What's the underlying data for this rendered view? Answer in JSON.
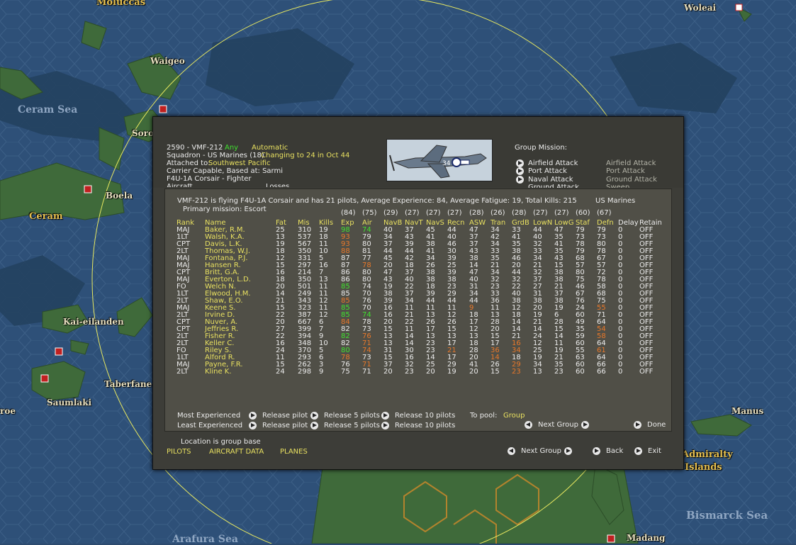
{
  "map": {
    "labels": [
      {
        "text": "Moluccas",
        "kind": "islandName"
      },
      {
        "text": "Waigeo",
        "kind": "land"
      },
      {
        "text": "Ceram Sea",
        "kind": "seaLabel"
      },
      {
        "text": "Soro",
        "kind": "land"
      },
      {
        "text": "Boela",
        "kind": "land"
      },
      {
        "text": "Ceram",
        "kind": "islandName"
      },
      {
        "text": "Kai-eilanden",
        "kind": "land"
      },
      {
        "text": "Taberfane",
        "kind": "land"
      },
      {
        "text": "Saumlaki",
        "kind": "land"
      },
      {
        "text": "roe",
        "kind": "land"
      },
      {
        "text": "Woleai",
        "kind": "land"
      },
      {
        "text": "Manus",
        "kind": "land"
      },
      {
        "text": "Admiralty",
        "kind": "islandName"
      },
      {
        "text": "Islands",
        "kind": "islandName"
      },
      {
        "text": "Bismarck Sea",
        "kind": "seaLabel"
      },
      {
        "text": "Madang",
        "kind": "land"
      },
      {
        "text": "Arafura Sea",
        "kind": "seaLabel"
      }
    ]
  },
  "header": {
    "unit_id": "2590 - VMF-212",
    "any_label": "Any",
    "auto_label": "Automatic",
    "squadron": "Squadron - US Marines (18)",
    "changing": "Changing to 24 in Oct 44",
    "attached_label": "Attached to:",
    "attached_value": "Southwest Pacific",
    "carrier": "Carrier Capable, Based at: Sarmi",
    "aircraft": "F4U-1A Corsair - Fighter",
    "cut_left": "Aircraft",
    "cut_right": "Losses",
    "plane_marking": "34",
    "group_mission_label": "Group Mission:",
    "missions": [
      {
        "label": "Airfield Attack",
        "current": "Airfield Attack"
      },
      {
        "label": "Port Attack",
        "current": "Port Attack"
      },
      {
        "label": "Naval Attack",
        "current": "Ground Attack"
      },
      {
        "label": "Ground Attack",
        "current": "Sweep"
      }
    ]
  },
  "summary": {
    "line": "VMF-212 is flying F4U-1A Corsair and has 21 pilots,  Average Experience: 84, Average Fatigue: 19, Total Kills: 215",
    "service": "US Marines",
    "primary": "Primary mission: Escort"
  },
  "table": {
    "averages": [
      "(84)",
      "(75)",
      "(29)",
      "(27)",
      "(27)",
      "(27)",
      "(28)",
      "(26)",
      "(28)",
      "(27)",
      "(27)",
      "(60)",
      "(67)"
    ],
    "headers": [
      "Rank",
      "Name",
      "Fat",
      "Mis",
      "Kills",
      "Exp",
      "Air",
      "NavB",
      "NavT",
      "NavS",
      "Recn",
      "ASW",
      "Tran",
      "GrdB",
      "LowN",
      "LowG",
      "Staf",
      "Defn",
      "Delay",
      "Retain"
    ],
    "rows": [
      {
        "rank": "MAJ",
        "name": "Baker, R.M.",
        "fat": "25",
        "mis": "310",
        "kills": "19",
        "exp": "98",
        "air": "74",
        "navb": "40",
        "navt": "37",
        "navs": "45",
        "recn": "44",
        "asw": "47",
        "tran": "34",
        "grdb": "33",
        "lown": "44",
        "lowg": "47",
        "staf": "79",
        "defn": "79",
        "delay": "0",
        "retain": "OFF",
        "c": {
          "exp": "g",
          "air": "g"
        }
      },
      {
        "rank": "1LT",
        "name": "Walsh, K.A.",
        "fat": "13",
        "mis": "537",
        "kills": "18",
        "exp": "93",
        "air": "79",
        "navb": "34",
        "navt": "43",
        "navs": "41",
        "recn": "40",
        "asw": "37",
        "tran": "42",
        "grdb": "41",
        "lown": "40",
        "lowg": "35",
        "staf": "73",
        "defn": "73",
        "delay": "0",
        "retain": "OFF",
        "c": {
          "exp": "o"
        }
      },
      {
        "rank": "CPT",
        "name": "Davis, L.K.",
        "fat": "19",
        "mis": "567",
        "kills": "11",
        "exp": "93",
        "air": "80",
        "navb": "37",
        "navt": "39",
        "navs": "38",
        "recn": "46",
        "asw": "37",
        "tran": "34",
        "grdb": "35",
        "lown": "32",
        "lowg": "41",
        "staf": "78",
        "defn": "80",
        "delay": "0",
        "retain": "OFF",
        "c": {
          "exp": "o"
        }
      },
      {
        "rank": "2LT",
        "name": "Thomas, W.J.",
        "fat": "18",
        "mis": "350",
        "kills": "10",
        "exp": "88",
        "air": "81",
        "navb": "44",
        "navt": "44",
        "navs": "41",
        "recn": "30",
        "asw": "43",
        "tran": "33",
        "grdb": "38",
        "lown": "33",
        "lowg": "35",
        "staf": "79",
        "defn": "78",
        "delay": "0",
        "retain": "OFF",
        "c": {
          "exp": "o"
        }
      },
      {
        "rank": "MAJ",
        "name": "Fontana, P.J.",
        "fat": "12",
        "mis": "331",
        "kills": "5",
        "exp": "87",
        "air": "77",
        "navb": "45",
        "navt": "42",
        "navs": "34",
        "recn": "39",
        "asw": "38",
        "tran": "35",
        "grdb": "46",
        "lown": "34",
        "lowg": "43",
        "staf": "68",
        "defn": "67",
        "delay": "0",
        "retain": "OFF",
        "c": {}
      },
      {
        "rank": "MAJ",
        "name": "Hansen R.",
        "fat": "15",
        "mis": "297",
        "kills": "16",
        "exp": "87",
        "air": "78",
        "navb": "20",
        "navt": "18",
        "navs": "26",
        "recn": "25",
        "asw": "14",
        "tran": "21",
        "grdb": "20",
        "lown": "21",
        "lowg": "15",
        "staf": "57",
        "defn": "57",
        "delay": "0",
        "retain": "OFF",
        "c": {
          "air": "o"
        }
      },
      {
        "rank": "CPT",
        "name": "Britt, G.A.",
        "fat": "16",
        "mis": "214",
        "kills": "7",
        "exp": "86",
        "air": "80",
        "navb": "47",
        "navt": "37",
        "navs": "38",
        "recn": "39",
        "asw": "47",
        "tran": "34",
        "grdb": "44",
        "lown": "32",
        "lowg": "38",
        "staf": "80",
        "defn": "72",
        "delay": "0",
        "retain": "OFF",
        "c": {}
      },
      {
        "rank": "MAJ",
        "name": "Everton, L.D.",
        "fat": "18",
        "mis": "350",
        "kills": "13",
        "exp": "86",
        "air": "80",
        "navb": "43",
        "navt": "40",
        "navs": "38",
        "recn": "38",
        "asw": "40",
        "tran": "32",
        "grdb": "32",
        "lown": "37",
        "lowg": "38",
        "staf": "75",
        "defn": "78",
        "delay": "0",
        "retain": "OFF",
        "c": {}
      },
      {
        "rank": "FO",
        "name": "Welch N.",
        "fat": "20",
        "mis": "501",
        "kills": "11",
        "exp": "85",
        "air": "74",
        "navb": "19",
        "navt": "22",
        "navs": "18",
        "recn": "23",
        "asw": "31",
        "tran": "23",
        "grdb": "22",
        "lown": "27",
        "lowg": "21",
        "staf": "46",
        "defn": "58",
        "delay": "0",
        "retain": "OFF",
        "c": {
          "exp": "g"
        }
      },
      {
        "rank": "1LT",
        "name": "Elwood, H.M.",
        "fat": "14",
        "mis": "249",
        "kills": "11",
        "exp": "85",
        "air": "70",
        "navb": "38",
        "navt": "37",
        "navs": "39",
        "recn": "29",
        "asw": "34",
        "tran": "33",
        "grdb": "40",
        "lown": "31",
        "lowg": "37",
        "staf": "67",
        "defn": "68",
        "delay": "0",
        "retain": "OFF",
        "c": {}
      },
      {
        "rank": "2LT",
        "name": "Shaw, E.O.",
        "fat": "21",
        "mis": "343",
        "kills": "12",
        "exp": "85",
        "air": "76",
        "navb": "39",
        "navt": "34",
        "navs": "44",
        "recn": "44",
        "asw": "44",
        "tran": "36",
        "grdb": "38",
        "lown": "38",
        "lowg": "38",
        "staf": "76",
        "defn": "75",
        "delay": "0",
        "retain": "OFF",
        "c": {
          "exp": "o"
        }
      },
      {
        "rank": "MAJ",
        "name": "Keene S.",
        "fat": "15",
        "mis": "323",
        "kills": "11",
        "exp": "85",
        "air": "70",
        "navb": "16",
        "navt": "11",
        "navs": "11",
        "recn": "11",
        "asw": "9",
        "tran": "11",
        "grdb": "12",
        "lown": "20",
        "lowg": "19",
        "staf": "24",
        "defn": "55",
        "delay": "0",
        "retain": "OFF",
        "c": {
          "exp": "g",
          "asw": "o",
          "defn": "o"
        }
      },
      {
        "rank": "2LT",
        "name": "Irvine D.",
        "fat": "22",
        "mis": "387",
        "kills": "12",
        "exp": "85",
        "air": "74",
        "navb": "16",
        "navt": "21",
        "navs": "13",
        "recn": "12",
        "asw": "18",
        "tran": "13",
        "grdb": "18",
        "lown": "19",
        "lowg": "6",
        "staf": "60",
        "defn": "71",
        "delay": "0",
        "retain": "OFF",
        "c": {
          "exp": "g",
          "air": "g"
        }
      },
      {
        "rank": "CPT",
        "name": "Nuver, A.",
        "fat": "20",
        "mis": "667",
        "kills": "6",
        "exp": "84",
        "air": "78",
        "navb": "20",
        "navt": "22",
        "navs": "26",
        "recn": "26",
        "asw": "17",
        "tran": "28",
        "grdb": "14",
        "lown": "21",
        "lowg": "28",
        "staf": "49",
        "defn": "64",
        "delay": "0",
        "retain": "OFF",
        "c": {
          "exp": "o"
        }
      },
      {
        "rank": "CPT",
        "name": "Jeffries R.",
        "fat": "27",
        "mis": "399",
        "kills": "7",
        "exp": "82",
        "air": "73",
        "navb": "15",
        "navt": "11",
        "navs": "17",
        "recn": "15",
        "asw": "12",
        "tran": "20",
        "grdb": "14",
        "lown": "14",
        "lowg": "15",
        "staf": "35",
        "defn": "54",
        "delay": "0",
        "retain": "OFF",
        "c": {
          "defn": "o"
        }
      },
      {
        "rank": "2LT",
        "name": "Fisher R.",
        "fat": "22",
        "mis": "394",
        "kills": "9",
        "exp": "82",
        "air": "76",
        "navb": "13",
        "navt": "14",
        "navs": "13",
        "recn": "13",
        "asw": "13",
        "tran": "15",
        "grdb": "21",
        "lown": "24",
        "lowg": "14",
        "staf": "59",
        "defn": "58",
        "delay": "0",
        "retain": "OFF",
        "c": {
          "exp": "g",
          "air": "o",
          "defn": "o"
        }
      },
      {
        "rank": "2LT",
        "name": "Keller C.",
        "fat": "16",
        "mis": "348",
        "kills": "10",
        "exp": "82",
        "air": "71",
        "navb": "13",
        "navt": "14",
        "navs": "23",
        "recn": "17",
        "asw": "18",
        "tran": "17",
        "grdb": "16",
        "lown": "12",
        "lowg": "11",
        "staf": "60",
        "defn": "64",
        "delay": "0",
        "retain": "OFF",
        "c": {
          "air": "o",
          "grdb": "o"
        }
      },
      {
        "rank": "FO",
        "name": "Riley S.",
        "fat": "24",
        "mis": "370",
        "kills": "5",
        "exp": "80",
        "air": "74",
        "navb": "31",
        "navt": "30",
        "navs": "23",
        "recn": "21",
        "asw": "28",
        "tran": "36",
        "grdb": "34",
        "lown": "25",
        "lowg": "19",
        "staf": "55",
        "defn": "61",
        "delay": "0",
        "retain": "OFF",
        "c": {
          "exp": "g",
          "air": "o",
          "recn": "o",
          "tran": "o",
          "grdb": "o",
          "defn": "o"
        }
      },
      {
        "rank": "1LT",
        "name": "Alford R.",
        "fat": "11",
        "mis": "293",
        "kills": "6",
        "exp": "78",
        "air": "73",
        "navb": "15",
        "navt": "16",
        "navs": "14",
        "recn": "17",
        "asw": "20",
        "tran": "14",
        "grdb": "18",
        "lown": "19",
        "lowg": "21",
        "staf": "63",
        "defn": "64",
        "delay": "0",
        "retain": "OFF",
        "c": {
          "exp": "o",
          "tran": "o"
        }
      },
      {
        "rank": "MAJ",
        "name": "Payne, F.R.",
        "fat": "15",
        "mis": "262",
        "kills": "3",
        "exp": "76",
        "air": "71",
        "navb": "37",
        "navt": "32",
        "navs": "25",
        "recn": "29",
        "asw": "41",
        "tran": "26",
        "grdb": "29",
        "lown": "34",
        "lowg": "35",
        "staf": "60",
        "defn": "66",
        "delay": "0",
        "retain": "OFF",
        "c": {
          "air": "o",
          "grdb": "o"
        }
      },
      {
        "rank": "2LT",
        "name": "Kline K.",
        "fat": "24",
        "mis": "298",
        "kills": "9",
        "exp": "75",
        "air": "71",
        "navb": "20",
        "navt": "23",
        "navs": "20",
        "recn": "19",
        "asw": "20",
        "tran": "15",
        "grdb": "23",
        "lown": "13",
        "lowg": "23",
        "staf": "60",
        "defn": "66",
        "delay": "0",
        "retain": "OFF",
        "c": {
          "grdb": "o"
        }
      }
    ]
  },
  "footer": {
    "most": "Most Experienced",
    "least": "Least Experienced",
    "release_pilot": "Release pilot",
    "release_5": "Release 5 pilots",
    "release_10": "Release 10 pilots",
    "to_pool": "To pool:",
    "pool_value": "Group",
    "next_group": "Next Group",
    "done": "Done",
    "location": "Location is group base",
    "tab_pilots": "PILOTS",
    "tab_aircraft": "AIRCRAFT DATA",
    "tab_planes": "PLANES",
    "next_group2": "Next Group",
    "back": "Back",
    "exit": "Exit"
  }
}
